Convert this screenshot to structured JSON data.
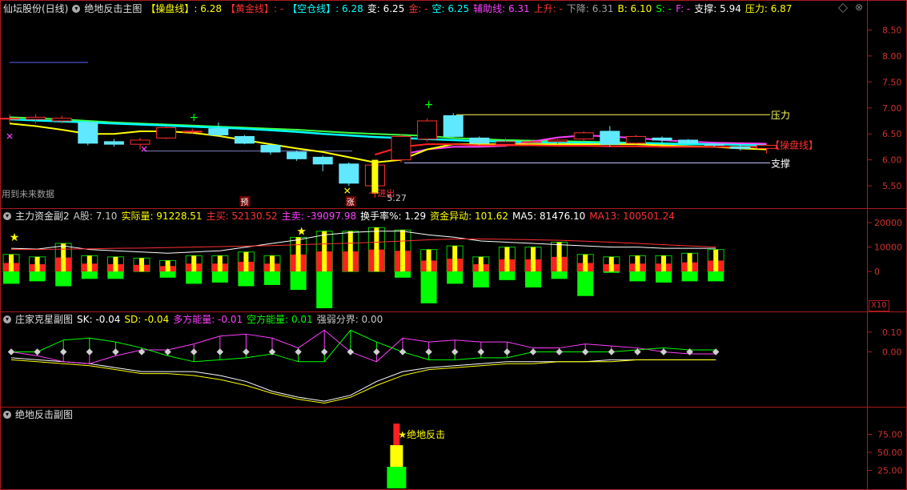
{
  "main": {
    "stock_label": "仙坛股份(日线)",
    "indicator_name": "绝地反击主图",
    "fields": [
      {
        "label": "【操盘线】",
        "value": "6.28",
        "color": "#ffff00"
      },
      {
        "label": "【黄金线】",
        "value": "-",
        "color": "#ff3030"
      },
      {
        "label": "【空仓线】",
        "value": "6.28",
        "color": "#00ffff"
      },
      {
        "label": "变",
        "value": "6.25",
        "color": "#ffffff"
      },
      {
        "label": "金",
        "value": "-",
        "color": "#ff3030"
      },
      {
        "label": "空",
        "value": "6.25",
        "color": "#00ffff"
      },
      {
        "label": "辅助线",
        "value": "6.31",
        "color": "#ff40ff"
      },
      {
        "label": "上升",
        "value": "-",
        "color": "#ff3030"
      },
      {
        "label": "下降",
        "value": "6.31",
        "color": "#a0a0a0"
      },
      {
        "label": "B",
        "value": "6.10",
        "color": "#ffff00"
      },
      {
        "label": "S",
        "value": "-",
        "color": "#00ff00"
      },
      {
        "label": "F",
        "value": "-",
        "color": "#ff40ff"
      },
      {
        "label": "支撑",
        "value": "5.94",
        "color": "#ffffff"
      },
      {
        "label": "压力",
        "value": "6.87",
        "color": "#ffff00"
      }
    ],
    "note_future": "用到未来数据",
    "label_pressure": "压力",
    "label_support": "支撑",
    "label_operate": "【操盘线】",
    "label_buy": "一进出",
    "low_price_label": "5.27",
    "signal_pre": "预",
    "signal_rise": "涨",
    "yaxis_ticks": [
      "8.50",
      "8.00",
      "7.50",
      "7.00",
      "6.50",
      "6.00",
      "5.50"
    ]
  },
  "sub1": {
    "indicator_name": "主力资金副2",
    "fields": [
      {
        "label": "A股",
        "value": "7.10",
        "color": "#c8c8c8"
      },
      {
        "label": "实际量",
        "value": "91228.51",
        "color": "#ffff00"
      },
      {
        "label": "主买",
        "value": "52130.52",
        "color": "#ff3030"
      },
      {
        "label": "主卖",
        "value": "-39097.98",
        "color": "#ff40ff"
      },
      {
        "label": "换手率%",
        "value": "1.29",
        "color": "#ffffff"
      },
      {
        "label": "资金异动",
        "value": "101.62",
        "color": "#ffff00"
      },
      {
        "label": "MA5",
        "value": "81476.10",
        "color": "#ffffff"
      },
      {
        "label": "MA13",
        "value": "100501.24",
        "color": "#ff3030"
      }
    ],
    "yaxis_ticks": [
      "20000",
      "10000",
      "0"
    ],
    "multiplier": "X10"
  },
  "sub2": {
    "indicator_name": "庄家克星副图",
    "fields": [
      {
        "label": "SK",
        "value": "-0.04",
        "color": "#ffffff"
      },
      {
        "label": "SD",
        "value": "-0.04",
        "color": "#ffff00"
      },
      {
        "label": "多方能量",
        "value": "-0.01",
        "color": "#ff40ff"
      },
      {
        "label": "空方能量",
        "value": "0.01",
        "color": "#00ff00"
      },
      {
        "label": "强弱分界",
        "value": "0.00",
        "color": "#c8c8c8"
      }
    ],
    "yaxis_ticks": [
      "0.10",
      "0.00"
    ]
  },
  "sub3": {
    "indicator_name": "绝地反击副图",
    "signal_label": "绝地反击",
    "yaxis_ticks": [
      "75.00",
      "50.00",
      "25.00"
    ]
  },
  "chart_data": [
    {
      "type": "candlestick",
      "title": "绝地反击主图",
      "ylim": [
        5.1,
        8.8
      ],
      "candles": [
        {
          "o": 6.8,
          "c": 6.8,
          "h": 6.88,
          "l": 6.72
        },
        {
          "o": 6.78,
          "c": 6.82,
          "h": 6.88,
          "l": 6.7
        },
        {
          "o": 6.75,
          "c": 6.8,
          "h": 6.85,
          "l": 6.7
        },
        {
          "o": 6.72,
          "c": 6.32,
          "h": 6.75,
          "l": 6.28
        },
        {
          "o": 6.35,
          "c": 6.3,
          "h": 6.4,
          "l": 6.25
        },
        {
          "o": 6.3,
          "c": 6.38,
          "h": 6.42,
          "l": 6.2
        },
        {
          "o": 6.42,
          "c": 6.62,
          "h": 6.65,
          "l": 6.4
        },
        {
          "o": 6.55,
          "c": 6.55,
          "h": 6.6,
          "l": 6.5
        },
        {
          "o": 6.6,
          "c": 6.48,
          "h": 6.72,
          "l": 6.45
        },
        {
          "o": 6.45,
          "c": 6.32,
          "h": 6.48,
          "l": 6.3
        },
        {
          "o": 6.28,
          "c": 6.15,
          "h": 6.3,
          "l": 6.1
        },
        {
          "o": 6.15,
          "c": 6.02,
          "h": 6.18,
          "l": 5.98
        },
        {
          "o": 6.05,
          "c": 5.92,
          "h": 6.08,
          "l": 5.78
        },
        {
          "o": 5.92,
          "c": 5.55,
          "h": 5.95,
          "l": 5.5
        },
        {
          "o": 5.5,
          "c": 5.9,
          "h": 5.95,
          "l": 5.27
        },
        {
          "o": 6.0,
          "c": 6.45,
          "h": 6.5,
          "l": 5.95
        },
        {
          "o": 6.4,
          "c": 6.75,
          "h": 6.8,
          "l": 6.35
        },
        {
          "o": 6.85,
          "c": 6.45,
          "h": 6.9,
          "l": 6.42
        },
        {
          "o": 6.42,
          "c": 6.32,
          "h": 6.45,
          "l": 6.28
        },
        {
          "o": 6.3,
          "c": 6.35,
          "h": 6.42,
          "l": 6.25
        },
        {
          "o": 6.35,
          "c": 6.35,
          "h": 6.38,
          "l": 6.32
        },
        {
          "o": 6.35,
          "c": 6.38,
          "h": 6.4,
          "l": 6.3
        },
        {
          "o": 6.4,
          "c": 6.52,
          "h": 6.55,
          "l": 6.35
        },
        {
          "o": 6.55,
          "c": 6.3,
          "h": 6.65,
          "l": 6.25
        },
        {
          "o": 6.32,
          "c": 6.45,
          "h": 6.48,
          "l": 6.3
        },
        {
          "o": 6.42,
          "c": 6.38,
          "h": 6.45,
          "l": 6.3
        },
        {
          "o": 6.38,
          "c": 6.32,
          "h": 6.4,
          "l": 6.3
        },
        {
          "o": 6.3,
          "c": 6.28,
          "h": 6.32,
          "l": 6.25
        },
        {
          "o": 6.25,
          "c": 6.22,
          "h": 6.3,
          "l": 6.18
        },
        {
          "o": 6.22,
          "c": 6.28,
          "h": 6.3,
          "l": 6.12
        }
      ],
      "series": [
        {
          "name": "操盘线",
          "color": "#40ff40",
          "values": [
            6.82,
            6.8,
            6.78,
            6.75,
            6.72,
            6.7,
            6.68,
            6.66,
            6.64,
            6.62,
            6.6,
            6.58,
            6.55,
            6.52,
            6.5,
            6.48,
            6.46,
            6.42,
            6.4,
            6.38,
            6.37,
            6.36,
            6.35,
            6.34,
            6.33,
            6.32,
            6.31,
            6.3,
            6.29,
            6.28
          ]
        },
        {
          "name": "空仓线",
          "color": "#00ffff",
          "values": [
            6.78,
            6.76,
            6.74,
            6.72,
            6.7,
            6.68,
            6.66,
            6.64,
            6.62,
            6.6,
            6.57,
            6.54,
            6.5,
            6.47,
            6.44,
            6.42,
            6.4,
            6.38,
            6.36,
            6.35,
            6.34,
            6.33,
            6.33,
            6.32,
            6.32,
            6.31,
            6.3,
            6.3,
            6.29,
            6.28
          ]
        },
        {
          "name": "辅助线",
          "color": "#ff40ff",
          "values": [
            null,
            null,
            null,
            null,
            null,
            null,
            null,
            null,
            null,
            null,
            null,
            null,
            null,
            null,
            null,
            6.1,
            6.2,
            6.25,
            6.25,
            6.27,
            6.35,
            6.43,
            6.47,
            6.45,
            6.42,
            6.38,
            6.35,
            6.33,
            6.32,
            6.31
          ]
        },
        {
          "name": "下降",
          "color": "#ffff00",
          "values": [
            6.7,
            6.65,
            6.58,
            6.5,
            6.5,
            6.55,
            6.55,
            6.52,
            6.46,
            6.38,
            6.3,
            6.22,
            6.15,
            6.05,
            5.95,
            6.0,
            6.2,
            6.3,
            6.3,
            6.3,
            6.3,
            6.3,
            6.3,
            6.3,
            6.3,
            6.28,
            6.26,
            6.25,
            6.22,
            6.2
          ]
        },
        {
          "name": "红线",
          "color": "#ff2020",
          "values": [
            null,
            null,
            null,
            null,
            null,
            null,
            null,
            null,
            null,
            null,
            null,
            null,
            null,
            null,
            6.1,
            6.25,
            6.3,
            6.3,
            6.28,
            6.28,
            6.28,
            6.27,
            6.27,
            6.26,
            6.26,
            6.25,
            6.25,
            6.25,
            6.25,
            6.25
          ]
        }
      ],
      "levels": {
        "压力": 6.87,
        "支撑": 5.94
      }
    },
    {
      "type": "bar",
      "title": "主力资金副2",
      "ylim": [
        -16000,
        22000
      ],
      "buy": [
        7000,
        6000,
        11500,
        6500,
        6000,
        5500,
        4500,
        6500,
        6500,
        8000,
        6500,
        14000,
        16500,
        16500,
        18000,
        17000,
        9000,
        10500,
        6000,
        10000,
        10000,
        12000,
        7000,
        6000,
        6500,
        6500,
        7500,
        9000
      ],
      "sell": [
        -5000,
        -4000,
        -6000,
        -3000,
        -3000,
        0,
        -2500,
        -5000,
        -4500,
        -6000,
        -5500,
        -7500,
        -15000,
        0,
        0,
        -2500,
        -13000,
        -5000,
        -6500,
        -3500,
        -6500,
        -3000,
        -10000,
        -500,
        -4000,
        -4500,
        -4000,
        -4000
      ],
      "ma5": [
        9500,
        9200,
        10500,
        9000,
        8500,
        8000,
        7500,
        8000,
        8500,
        10000,
        11500,
        13000,
        15000,
        16000,
        16500,
        16500,
        15000,
        14000,
        12500,
        12000,
        11500,
        11000,
        10500,
        10000,
        10000,
        9500,
        9500,
        9500
      ],
      "ma13": [
        9000,
        9000,
        9200,
        9300,
        9500,
        9600,
        9800,
        10000,
        10200,
        10400,
        10600,
        11000,
        11300,
        11600,
        12000,
        12500,
        13000,
        13300,
        13300,
        13200,
        13000,
        12800,
        12400,
        12000,
        11500,
        11000,
        10500,
        10000
      ]
    },
    {
      "type": "line",
      "title": "庄家克星副图",
      "ylim": [
        -0.27,
        0.14
      ],
      "series": [
        {
          "name": "SK",
          "color": "#ffffff",
          "values": [
            -0.03,
            -0.04,
            -0.05,
            -0.06,
            -0.08,
            -0.1,
            -0.1,
            -0.1,
            -0.12,
            -0.15,
            -0.2,
            -0.23,
            -0.25,
            -0.22,
            -0.15,
            -0.1,
            -0.08,
            -0.07,
            -0.06,
            -0.05,
            -0.05,
            -0.05,
            -0.05,
            -0.04,
            -0.04,
            -0.04,
            -0.04,
            -0.04
          ]
        },
        {
          "name": "SD",
          "color": "#ffff00",
          "values": [
            -0.04,
            -0.05,
            -0.06,
            -0.07,
            -0.09,
            -0.11,
            -0.11,
            -0.12,
            -0.14,
            -0.17,
            -0.21,
            -0.24,
            -0.26,
            -0.23,
            -0.17,
            -0.12,
            -0.09,
            -0.08,
            -0.07,
            -0.06,
            -0.06,
            -0.05,
            -0.05,
            -0.05,
            -0.04,
            -0.04,
            -0.04,
            -0.04
          ]
        },
        {
          "name": "多方能量",
          "color": "#ff40ff",
          "values": [
            0.0,
            -0.02,
            -0.05,
            -0.06,
            -0.02,
            0.01,
            0.01,
            0.04,
            0.08,
            0.09,
            0.07,
            0.02,
            0.11,
            0.0,
            -0.05,
            0.07,
            0.05,
            0.06,
            0.05,
            0.05,
            0.02,
            0.02,
            0.04,
            0.03,
            0.02,
            0.0,
            -0.01,
            -0.01
          ]
        },
        {
          "name": "空方能量",
          "color": "#00ff00",
          "values": [
            0.0,
            0.0,
            0.06,
            0.07,
            0.05,
            0.02,
            -0.02,
            -0.05,
            -0.04,
            -0.03,
            -0.01,
            -0.05,
            -0.05,
            0.11,
            0.05,
            0.0,
            -0.04,
            -0.04,
            -0.03,
            -0.03,
            0.0,
            0.0,
            0.0,
            0.0,
            0.01,
            0.02,
            0.01,
            0.01
          ]
        }
      ]
    },
    {
      "type": "bar",
      "title": "绝地反击副图",
      "ylim": [
        0,
        100
      ],
      "signal_index": 14,
      "stack": [
        {
          "from": 0,
          "to": 30,
          "color": "#00ff00"
        },
        {
          "from": 30,
          "to": 60,
          "color": "#ffff00"
        },
        {
          "from": 60,
          "to": 90,
          "color": "#ff2020"
        }
      ]
    }
  ]
}
